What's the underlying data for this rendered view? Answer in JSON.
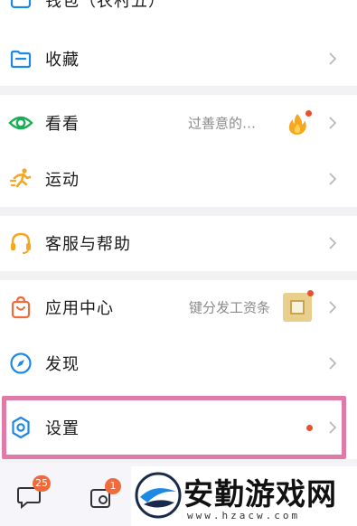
{
  "top_partial": {
    "label": "钱包（农村五）"
  },
  "menu": {
    "favorites": {
      "label": "收藏",
      "icon": "folder-icon"
    },
    "kankan": {
      "label": "看看",
      "sub": "过善意的…",
      "icon": "eye-icon"
    },
    "sport": {
      "label": "运动",
      "icon": "running-icon"
    },
    "service": {
      "label": "客服与帮助",
      "icon": "headset-icon"
    },
    "appcenter": {
      "label": "应用中心",
      "sub": "键分发工资条",
      "icon": "shopping-bag-icon"
    },
    "discover": {
      "label": "发现",
      "icon": "compass-icon"
    },
    "settings": {
      "label": "设置",
      "icon": "gear-icon"
    }
  },
  "tabbar": {
    "messages_badge": "25",
    "contacts_badge": "1"
  },
  "watermark": {
    "text": "安勤游戏网",
    "url": "www.hzacw.com"
  },
  "colors": {
    "accent_orange": "#e8502e",
    "highlight_pink": "#e07aa6",
    "icon_blue": "#1e88e5",
    "icon_green": "#1aad57",
    "icon_orange": "#f5a623"
  }
}
